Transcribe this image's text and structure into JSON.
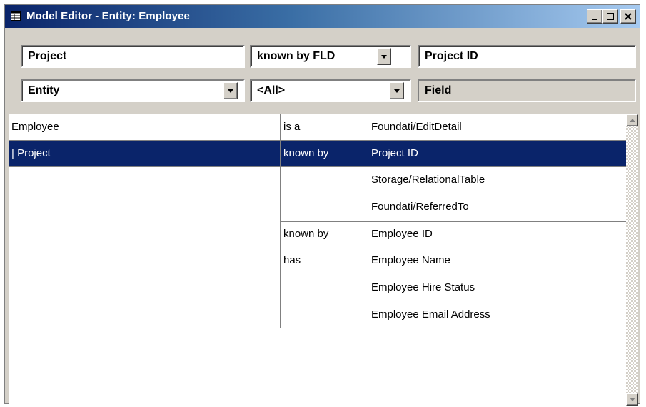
{
  "window": {
    "title": "Model Editor - Entity: Employee"
  },
  "filters": {
    "subject": "Project",
    "relation": "known by FLD",
    "object": "Project ID",
    "subject_type": "Entity",
    "relation_filter": "<All>",
    "object_type": "Field"
  },
  "grid": {
    "rows": [
      {
        "c1": "Employee",
        "c2": "is a",
        "c3": "Foundati/EditDetail"
      },
      {
        "c1": "| Project",
        "c2": "known by",
        "c3": "Project ID"
      },
      {
        "c1": "",
        "c2": "",
        "c3": "Storage/RelationalTable"
      },
      {
        "c1": "",
        "c2": "",
        "c3": "Foundati/ReferredTo"
      },
      {
        "c1": "",
        "c2": "known by",
        "c3": "Employee ID"
      },
      {
        "c1": "",
        "c2": "has",
        "c3": "Employee Name"
      },
      {
        "c1": "",
        "c2": "",
        "c3": "Employee Hire Status"
      },
      {
        "c1": "",
        "c2": "",
        "c3": "Employee Email Address"
      }
    ],
    "selected_row": 1
  },
  "colors": {
    "titlebar_start": "#0a246a",
    "titlebar_end": "#a6caf0",
    "selection": "#0a246a",
    "face": "#d4d0c8"
  },
  "icons": [
    "window-menu-icon",
    "minimize-icon",
    "maximize-icon",
    "close-icon",
    "dropdown-arrow-icon",
    "scroll-up-icon",
    "scroll-down-icon"
  ]
}
